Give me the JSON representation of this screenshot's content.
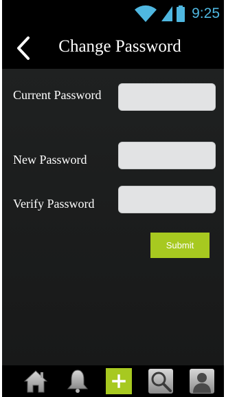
{
  "status_bar": {
    "time": "9:25",
    "icons": [
      "wifi-icon",
      "signal-icon",
      "battery-icon"
    ],
    "accent_color": "#4fb7e0"
  },
  "header": {
    "title": "Change Password",
    "back_icon": "chevron-left-icon"
  },
  "form": {
    "current_password_label": "Current Password",
    "current_password_value": "",
    "new_password_label": "New Password",
    "new_password_value": "",
    "verify_password_label": "Verify Password",
    "verify_password_value": "",
    "submit_label": "Submit",
    "submit_color": "#a7c920"
  },
  "bottom_nav": {
    "items": [
      {
        "icon": "home-icon"
      },
      {
        "icon": "bell-icon"
      },
      {
        "icon": "plus-icon",
        "active": true,
        "color": "#a7c920"
      },
      {
        "icon": "search-icon"
      },
      {
        "icon": "user-icon"
      }
    ]
  }
}
